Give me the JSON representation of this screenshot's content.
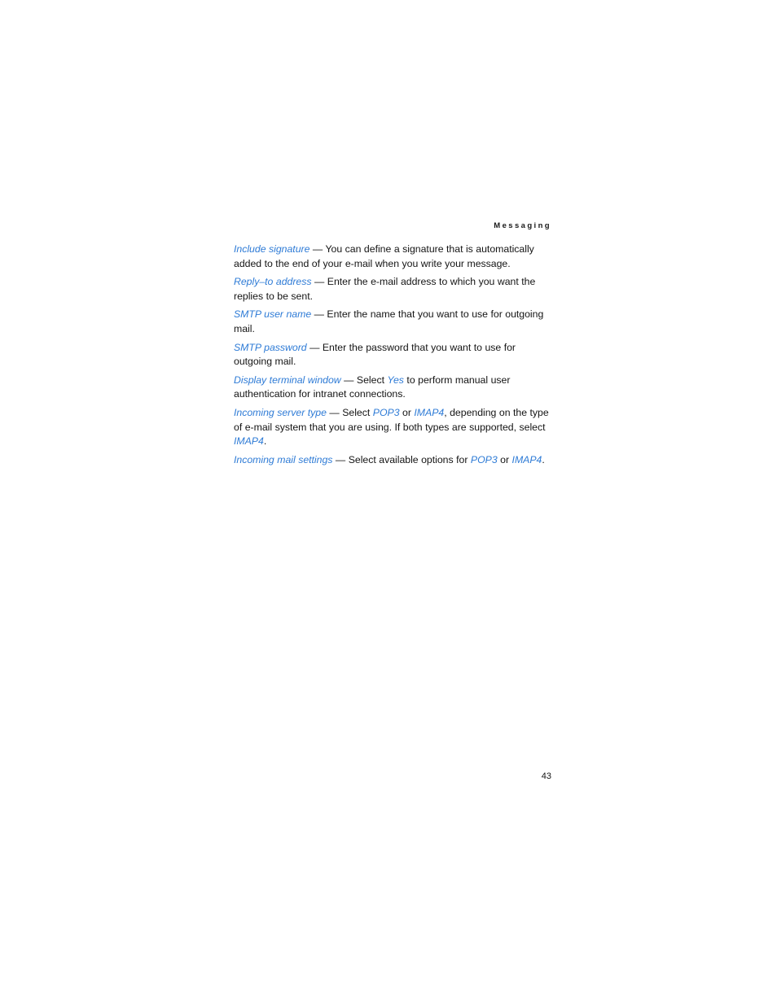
{
  "page": {
    "running_head": "Messaging",
    "folio": "43",
    "background_color": "#ffffff",
    "body_text_color": "#141414",
    "accent_color": "#2e7bd6"
  },
  "paragraphs": [
    {
      "term": "Include signature",
      "dash": " — ",
      "text_1": "You can define a signature that is automatically added to the end of your e-mail when you write your message."
    },
    {
      "term": "Reply–to address",
      "dash": " — ",
      "text_1": "Enter the e-mail address to which you want the replies to be sent."
    },
    {
      "term": "SMTP user name",
      "dash": " — ",
      "text_1": "Enter the name that you want to use for outgoing mail."
    },
    {
      "term": "SMTP password",
      "dash": " — ",
      "text_1": "Enter the password that you want to use for outgoing mail."
    },
    {
      "term": "Display terminal window",
      "dash": " — ",
      "text_1": "Select ",
      "value_1": "Yes",
      "text_2": " to perform manual user authentication for intranet connections."
    },
    {
      "term": "Incoming server type",
      "dash": " — ",
      "text_1": "Select ",
      "value_1": "POP3",
      "text_2": " or ",
      "value_2": "IMAP4",
      "text_3": ", depending on the type of e-mail system that you are using. If both types are supported, select ",
      "value_3": "IMAP4",
      "text_4": "."
    },
    {
      "term": "Incoming mail settings",
      "dash": " — ",
      "text_1": "Select available options for ",
      "value_1": "POP3",
      "text_2": " or ",
      "value_2": "IMAP4",
      "text_3": "."
    }
  ]
}
